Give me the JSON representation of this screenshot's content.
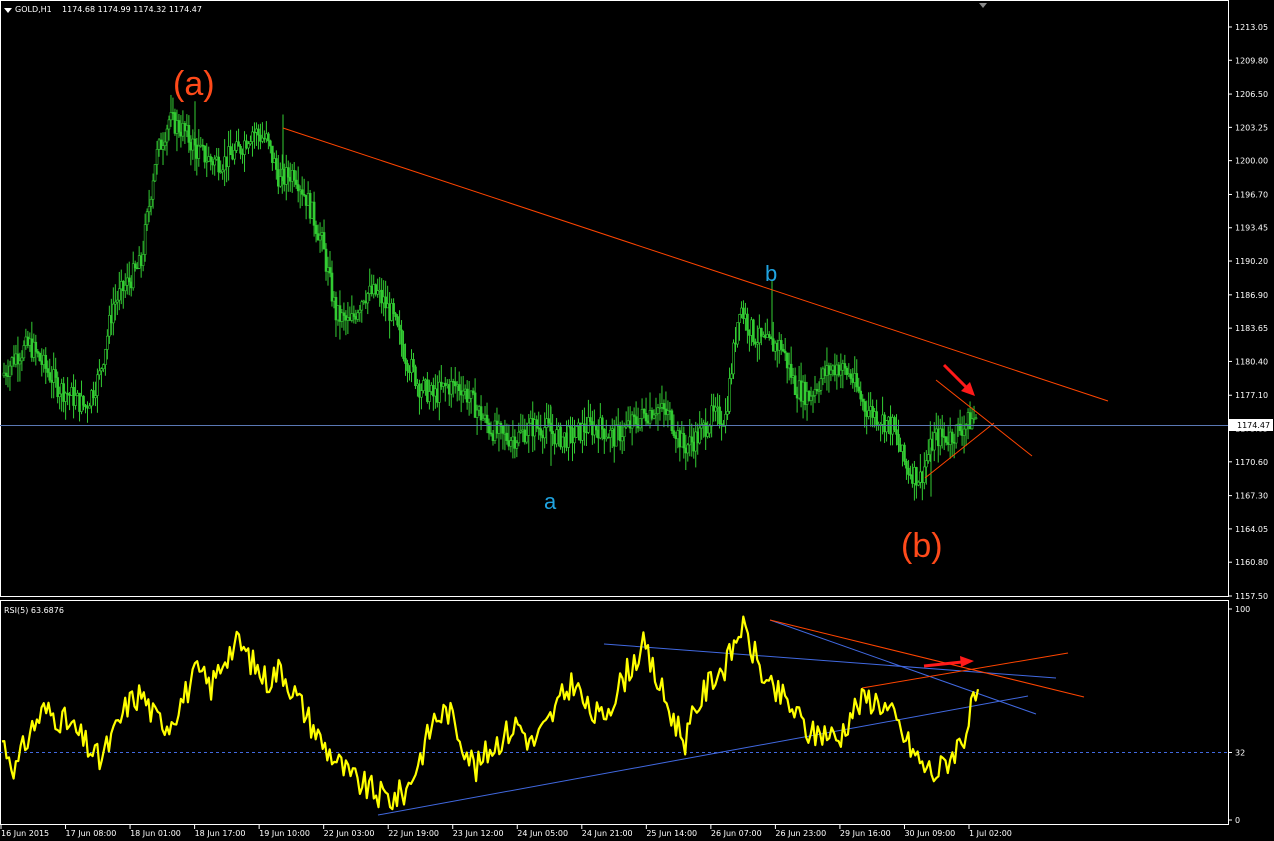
{
  "header": {
    "symbol": "GOLD,H1",
    "ohlc": "1174.68 1174.99 1174.32 1174.47"
  },
  "rsi_header": "RSI(5) 63.6876",
  "colors": {
    "background": "#000000",
    "axis": "#ffffff",
    "candle": "#33cc33",
    "trend_red": "#ff4500",
    "trend_blue": "#4169e1",
    "rsi_line": "#ffff00",
    "price_line": "#5a78b4",
    "arrow": "#ff1a1a",
    "wave_big_label": "#ff4a1a",
    "wave_small_label": "#1fa3e0"
  },
  "wave_labels": {
    "big_a": "(a)",
    "big_b": "(b)",
    "small_a": "a",
    "small_b": "b"
  },
  "chart_data": [
    {
      "type": "candlestick",
      "symbol": "GOLD",
      "timeframe": "H1",
      "price_ticks": [
        "1213.05",
        "1209.80",
        "1206.50",
        "1203.25",
        "1200.00",
        "1196.70",
        "1193.45",
        "1190.20",
        "1186.90",
        "1183.65",
        "1180.40",
        "1177.10",
        "1173.85",
        "1170.60",
        "1167.30",
        "1164.05",
        "1160.80",
        "1157.50"
      ],
      "ylim": [
        1157.5,
        1215.0
      ],
      "current_price": "1174.47",
      "x_tick_labels": [
        "16 Jun 2015",
        "17 Jun 08:00",
        "18 Jun 01:00",
        "18 Jun 17:00",
        "19 Jun 10:00",
        "22 Jun 03:00",
        "22 Jun 19:00",
        "23 Jun 12:00",
        "24 Jun 05:00",
        "24 Jun 21:00",
        "25 Jun 14:00",
        "26 Jun 07:00",
        "26 Jun 23:00",
        "29 Jun 16:00",
        "30 Jun 09:00",
        "1 Jul 02:00"
      ],
      "close_path": [
        1179,
        1181,
        1182,
        1180,
        1178,
        1177,
        1176,
        1179,
        1186,
        1188,
        1190,
        1200,
        1204,
        1203,
        1201,
        1200,
        1200,
        1201,
        1203,
        1202,
        1198,
        1199,
        1196,
        1192,
        1185,
        1184,
        1187,
        1187,
        1185,
        1181,
        1178,
        1177,
        1178,
        1178,
        1176,
        1174,
        1173,
        1173,
        1174,
        1174,
        1173,
        1173,
        1174,
        1174,
        1173,
        1174,
        1175,
        1176,
        1175,
        1172,
        1173,
        1175,
        1175,
        1186,
        1183,
        1182,
        1182,
        1178,
        1177,
        1179,
        1180,
        1179,
        1176,
        1175,
        1174,
        1170,
        1169,
        1173,
        1173,
        1174,
        1175
      ],
      "annotations": [
        "(a)",
        "a",
        "b",
        "(b)"
      ]
    },
    {
      "type": "line",
      "name": "RSI(5)",
      "value": 63.6876,
      "y_ticks": [
        "100",
        "32",
        "0"
      ],
      "ylim": [
        0,
        100
      ],
      "level": 32,
      "x_tick_labels": [
        "16 Jun 2015",
        "17 Jun 08:00",
        "18 Jun 01:00",
        "18 Jun 17:00",
        "19 Jun 10:00",
        "22 Jun 03:00",
        "22 Jun 19:00",
        "23 Jun 12:00",
        "24 Jun 05:00",
        "24 Jun 21:00",
        "25 Jun 14:00",
        "26 Jun 07:00",
        "26 Jun 23:00",
        "29 Jun 16:00",
        "30 Jun 09:00",
        "1 Jul 02:00"
      ],
      "values": [
        38,
        24,
        42,
        52,
        49,
        44,
        36,
        28,
        40,
        55,
        60,
        48,
        46,
        58,
        70,
        63,
        78,
        84,
        74,
        66,
        72,
        60,
        48,
        36,
        28,
        20,
        16,
        12,
        10,
        14,
        30,
        48,
        52,
        38,
        24,
        34,
        40,
        46,
        36,
        44,
        56,
        66,
        52,
        48,
        60,
        72,
        82,
        66,
        50,
        38,
        56,
        68,
        74,
        92,
        78,
        62,
        58,
        50,
        40,
        42,
        38,
        52,
        58,
        56,
        48,
        36,
        26,
        22,
        30,
        40,
        62
      ]
    }
  ]
}
